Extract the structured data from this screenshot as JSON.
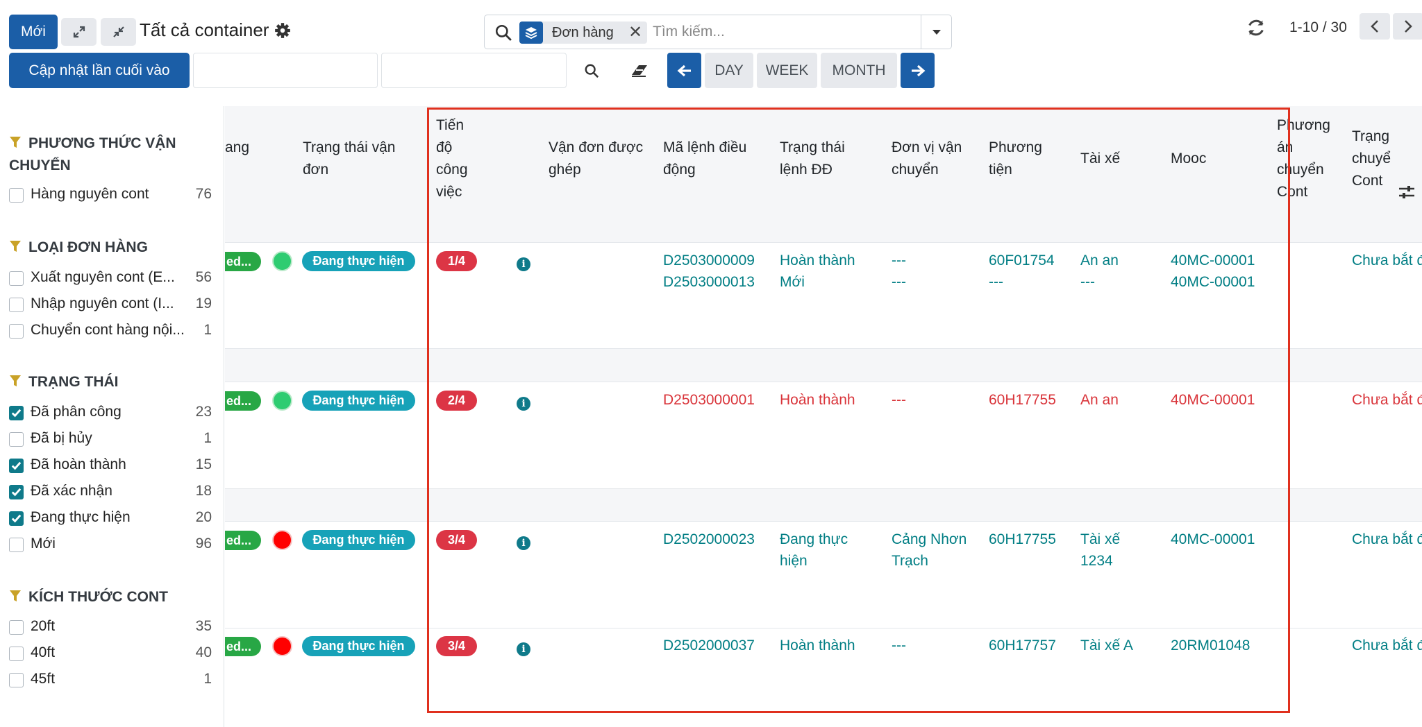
{
  "toolbar": {
    "new_label": "Mới",
    "view_title": "Tất cả container",
    "update_label": "Cập nhật lần cuối vào",
    "day_label": "DAY",
    "week_label": "WEEK",
    "month_label": "MONTH"
  },
  "search": {
    "facet_label": "Đơn hàng",
    "placeholder": "Tìm kiếm..."
  },
  "pager": {
    "value": "1-10 / 30"
  },
  "sidebar": {
    "groups": [
      {
        "title_line1": "PHƯƠNG THỨC VẬN",
        "title_line2": "CHUYỂN",
        "items": [
          {
            "label": "Hàng nguyên cont",
            "count": "76",
            "checked": false
          }
        ]
      },
      {
        "title": "LOẠI ĐƠN HÀNG",
        "items": [
          {
            "label": "Xuất nguyên cont (E...",
            "count": "56",
            "checked": false
          },
          {
            "label": "Nhập nguyên cont (I...",
            "count": "19",
            "checked": false
          },
          {
            "label": "Chuyển cont hàng nội...",
            "count": "1",
            "checked": false
          }
        ]
      },
      {
        "title": "TRẠNG THÁI",
        "items": [
          {
            "label": "Đã phân công",
            "count": "23",
            "checked": true
          },
          {
            "label": "Đã bị hủy",
            "count": "1",
            "checked": false
          },
          {
            "label": "Đã hoàn thành",
            "count": "15",
            "checked": true
          },
          {
            "label": "Đã xác nhận",
            "count": "18",
            "checked": true
          },
          {
            "label": "Đang thực hiện",
            "count": "20",
            "checked": true
          },
          {
            "label": "Mới",
            "count": "96",
            "checked": false
          }
        ]
      },
      {
        "title": "KÍCH THƯỚC CONT",
        "items": [
          {
            "label": "20ft",
            "count": "35",
            "checked": false
          },
          {
            "label": "40ft",
            "count": "40",
            "checked": false
          },
          {
            "label": "45ft",
            "count": "1",
            "checked": false
          }
        ]
      }
    ]
  },
  "table": {
    "headers": {
      "col_partial": "ang",
      "trang_thai_van_don": [
        "Trạng thái vận",
        "đơn"
      ],
      "tien_do": [
        "Tiến",
        "độ",
        "công",
        "việc"
      ],
      "van_don_ghep": [
        "Vận đơn được",
        "ghép"
      ],
      "ma_lenh": [
        "Mã lệnh điều",
        "động"
      ],
      "trang_thai_lenh": [
        "Trạng thái",
        "lệnh ĐĐ"
      ],
      "don_vi": [
        "Đơn vị vận",
        "chuyển"
      ],
      "phuong_tien": [
        "Phương",
        "tiện"
      ],
      "tai_xe": "Tài xế",
      "mooc": "Mooc",
      "phuong_an": [
        "Phương",
        "án",
        "chuyển",
        "Cont"
      ],
      "trang_thai_cont": [
        "Trạng",
        "chuyể",
        "Cont"
      ]
    },
    "rows": [
      {
        "status_pill": "ed...",
        "dot": "green",
        "trang_thai": "Đang thực hiện",
        "progress": "1/4",
        "color": "teal",
        "ma_lenh": [
          "D2503000009",
          "D2503000013"
        ],
        "trang_thai_lenh": [
          "Hoàn thành",
          "Mới"
        ],
        "don_vi": [
          "---",
          "---"
        ],
        "phuong_tien": [
          "60F01754",
          "---"
        ],
        "tai_xe": [
          "An an",
          "---"
        ],
        "mooc": [
          "40MC-00001",
          "40MC-00001"
        ],
        "trang_thai_cont": "Chưa bắt đ"
      },
      {
        "status_pill": "ed...",
        "dot": "green",
        "trang_thai": "Đang thực hiện",
        "progress": "2/4",
        "color": "red",
        "ma_lenh": [
          "D2503000001"
        ],
        "trang_thai_lenh": [
          "Hoàn thành"
        ],
        "don_vi": [
          "---"
        ],
        "phuong_tien": [
          "60H17755"
        ],
        "tai_xe": [
          "An an"
        ],
        "mooc": [
          "40MC-00001"
        ],
        "trang_thai_cont": "Chưa bắt đ"
      },
      {
        "status_pill": "ed...",
        "dot": "red",
        "trang_thai": "Đang thực hiện",
        "progress": "3/4",
        "color": "teal",
        "ma_lenh": [
          "D2502000023"
        ],
        "trang_thai_lenh": [
          "Đang thực",
          "hiện"
        ],
        "don_vi": [
          "Cảng Nhơn",
          "Trạch"
        ],
        "phuong_tien": [
          "60H17755"
        ],
        "tai_xe": [
          "Tài xế",
          "1234"
        ],
        "mooc": [
          "40MC-00001"
        ],
        "trang_thai_cont": "Chưa bắt đ"
      },
      {
        "status_pill": "ed...",
        "dot": "red",
        "trang_thai": "Đang thực hiện",
        "progress": "3/4",
        "color": "teal",
        "ma_lenh": [
          "D2502000037"
        ],
        "trang_thai_lenh": [
          "Hoàn thành"
        ],
        "don_vi": [
          "---"
        ],
        "phuong_tien": [
          "60H17757"
        ],
        "tai_xe": [
          "Tài xế A"
        ],
        "mooc": [
          "20RM01048"
        ],
        "trang_thai_cont": "Chưa bắt đ"
      }
    ]
  },
  "colors": {
    "primary": "#1b5ea7",
    "teal_text": "#017e84",
    "red_text": "#d9343a",
    "info_pill": "#17a2b8",
    "danger_pill": "#dc3545",
    "highlight_border": "#e0301e"
  }
}
